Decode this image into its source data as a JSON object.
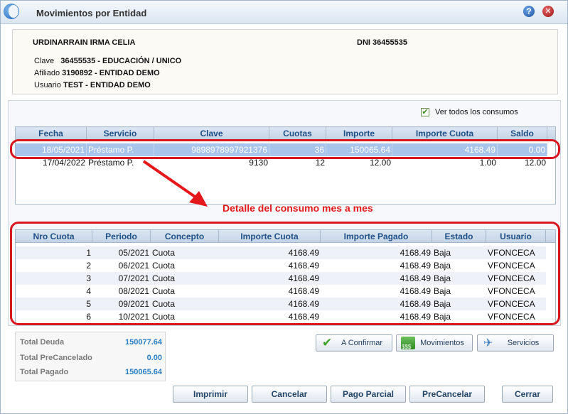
{
  "window": {
    "title": "Movimientos por Entidad"
  },
  "header": {
    "name": "URDINARRAIN IRMA CELIA",
    "dni_label": "DNI",
    "dni_value": "36455535",
    "clave_label": "Clave",
    "clave_value": "36455535  -  EDUCACIÓN / UNICO",
    "afiliado_label": "Afiliado",
    "afiliado_value": "3190892  -  ENTIDAD DEMO",
    "usuario_label": "Usuario",
    "usuario_value": "TEST  -  ENTIDAD DEMO"
  },
  "filter": {
    "checkbox_label": "Ver todos los consumos",
    "checked": true
  },
  "consumos": {
    "columns": [
      "Fecha",
      "Servicio",
      "Clave",
      "Cuotas",
      "Importe",
      "Importe Cuota",
      "Saldo"
    ],
    "rows": [
      [
        "18/05/2021",
        "Préstamo P.",
        "9898978997921376",
        "36",
        "150065.64",
        "4168.49",
        "0.00"
      ],
      [
        "17/04/2022",
        "Préstamo P.",
        "9130",
        "12",
        "12.00",
        "1.00",
        "12.00"
      ]
    ]
  },
  "annotation": {
    "text": "Detalle del consumo mes a mes",
    "color": "#e4171b"
  },
  "detalle": {
    "columns": [
      "Nro Cuota",
      "Periodo",
      "Concepto",
      "Importe Cuota",
      "Importe Pagado",
      "Estado",
      "Usuario"
    ],
    "rows": [
      [
        "1",
        "05/2021",
        "Cuota",
        "4168.49",
        "4168.49",
        "Baja",
        "VFONCECA"
      ],
      [
        "2",
        "06/2021",
        "Cuota",
        "4168.49",
        "4168.49",
        "Baja",
        "VFONCECA"
      ],
      [
        "3",
        "07/2021",
        "Cuota",
        "4168.49",
        "4168.49",
        "Baja",
        "VFONCECA"
      ],
      [
        "4",
        "08/2021",
        "Cuota",
        "4168.49",
        "4168.49",
        "Baja",
        "VFONCECA"
      ],
      [
        "5",
        "09/2021",
        "Cuota",
        "4168.49",
        "4168.49",
        "Baja",
        "VFONCECA"
      ],
      [
        "6",
        "10/2021",
        "Cuota",
        "4168.49",
        "4168.49",
        "Baja",
        "VFONCECA"
      ]
    ]
  },
  "totals": {
    "deuda_label": "Total Deuda",
    "deuda_value": "150077.64",
    "precancelado_label": "Total PreCancelado",
    "precancelado_value": "0.00",
    "pagado_label": "Total Pagado",
    "pagado_value": "150065.64"
  },
  "actions": {
    "a_confirmar": "A Confirmar",
    "movimientos": "Movimientos",
    "servicios": "Servicios",
    "imprimir": "Imprimir",
    "cancelar": "Cancelar",
    "pago_parcial": "Pago Parcial",
    "precancelar": "PreCancelar",
    "cerrar": "Cerrar"
  },
  "colors": {
    "accent_red": "#d8161e",
    "link_blue": "#2b7fc4",
    "header_blue": "#1e4f87"
  }
}
